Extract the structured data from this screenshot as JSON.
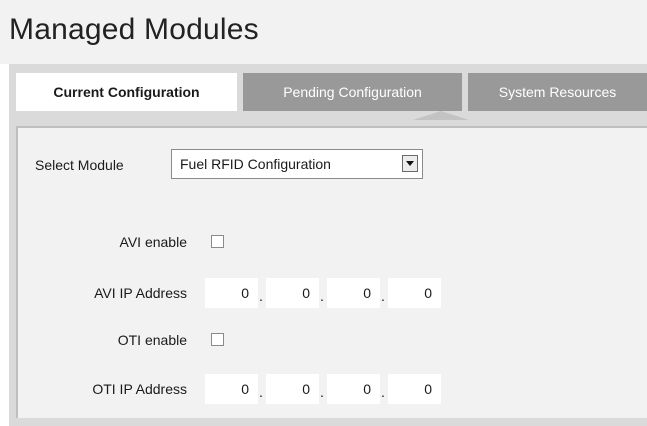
{
  "page": {
    "title": "Managed Modules"
  },
  "tabs": [
    {
      "label": "Current Configuration",
      "active": true
    },
    {
      "label": "Pending Configuration",
      "active": false
    },
    {
      "label": "System Resources",
      "active": false
    }
  ],
  "form": {
    "select_module_label": "Select Module",
    "select_module_value": "Fuel RFID Configuration",
    "avi_enable_label": "AVI enable",
    "avi_enable_checked": false,
    "avi_ip_label": "AVI IP Address",
    "avi_ip": [
      "0",
      "0",
      "0",
      "0"
    ],
    "oti_enable_label": "OTI enable",
    "oti_enable_checked": false,
    "oti_ip_label": "OTI IP Address",
    "oti_ip": [
      "0",
      "0",
      "0",
      "0"
    ],
    "ip_separator": "."
  },
  "colors": {
    "header_bg": "#f2f2f2",
    "tab_active_bg": "#ffffff",
    "tab_inactive_bg": "#999999",
    "panel_bg": "#f2f2f2"
  },
  "icons": {
    "select_arrow": "chevron-down-icon",
    "checkbox": "checkbox-unchecked"
  }
}
